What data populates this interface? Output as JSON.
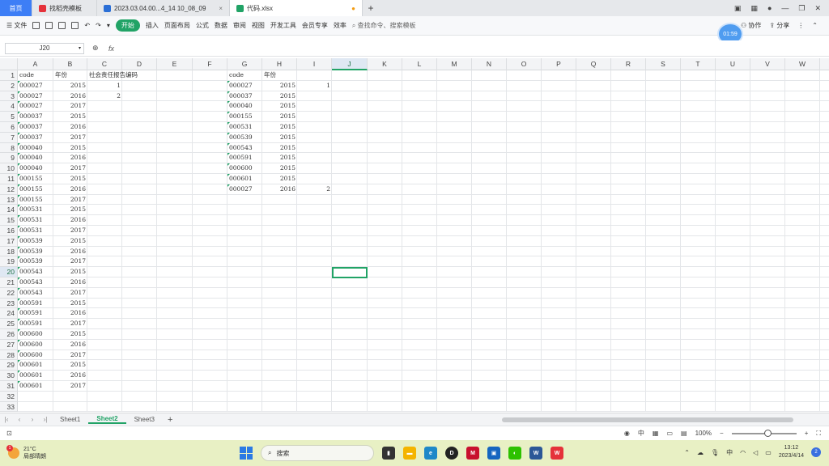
{
  "tabs": {
    "home": "首页",
    "tab1": "找稻壳模板",
    "tab2": "2023.03.04.00...4_14 10_08_09",
    "tab3": "代码.xlsx"
  },
  "colors": {
    "accent": "#21a366",
    "home_tab": "#3d7ef6"
  },
  "ribbon": {
    "menu": "文件",
    "start": "开始",
    "insert": "插入",
    "layout": "页面布局",
    "formula": "公式",
    "data": "数据",
    "review": "审阅",
    "view": "视图",
    "devtools": "开发工具",
    "member": "会员专享",
    "efficiency": "效率",
    "search": "查找命令、搜索模板",
    "collab": "协作",
    "share": "分享",
    "timer": "01:59"
  },
  "formula_bar": {
    "namebox": "J20",
    "fx": "fx"
  },
  "columns": [
    "A",
    "B",
    "C",
    "D",
    "E",
    "F",
    "G",
    "H",
    "I",
    "J",
    "K",
    "L",
    "M",
    "N",
    "O",
    "P",
    "Q",
    "R",
    "S",
    "T",
    "U",
    "V",
    "W"
  ],
  "rows": [
    "1",
    "2",
    "3",
    "4",
    "5",
    "6",
    "7",
    "8",
    "9",
    "10",
    "11",
    "12",
    "13",
    "14",
    "15",
    "16",
    "17",
    "18",
    "19",
    "20",
    "21",
    "22",
    "23",
    "24",
    "25",
    "26",
    "27",
    "28",
    "29",
    "30",
    "31",
    "32",
    "33"
  ],
  "sheet": {
    "A": [
      "code",
      "000027",
      "000027",
      "000027",
      "000037",
      "000037",
      "000037",
      "000040",
      "000040",
      "000040",
      "000155",
      "000155",
      "000155",
      "000531",
      "000531",
      "000531",
      "000539",
      "000539",
      "000539",
      "000543",
      "000543",
      "000543",
      "000591",
      "000591",
      "000591",
      "000600",
      "000600",
      "000600",
      "000601",
      "000601",
      "000601"
    ],
    "B": [
      "年份",
      "2015",
      "2016",
      "2017",
      "2015",
      "2016",
      "2017",
      "2015",
      "2016",
      "2017",
      "2015",
      "2016",
      "2017",
      "2015",
      "2016",
      "2017",
      "2015",
      "2016",
      "2017",
      "2015",
      "2016",
      "2017",
      "2015",
      "2016",
      "2017",
      "2015",
      "2016",
      "2017",
      "2015",
      "2016",
      "2017"
    ],
    "C": [
      "社会责任报告编码",
      "1",
      "2"
    ],
    "G": [
      "code",
      "000027",
      "000037",
      "000040",
      "000155",
      "000531",
      "000539",
      "000543",
      "000591",
      "000600",
      "000601",
      "000027"
    ],
    "H": [
      "年份",
      "2015",
      "2015",
      "2015",
      "2015",
      "2015",
      "2015",
      "2015",
      "2015",
      "2015",
      "2015",
      "2016"
    ],
    "I": [
      "",
      "1",
      "",
      "",
      "",
      "",
      "",
      "",
      "",
      "",
      "",
      "2"
    ]
  },
  "sheets": [
    "Sheet1",
    "Sheet2",
    "Sheet3"
  ],
  "active_sheet": "Sheet2",
  "status": {
    "zoom": "100%"
  },
  "taskbar": {
    "temp": "21°C",
    "weather": "局部晴朗",
    "search": "搜索",
    "ime": "中",
    "time": "13:12",
    "date": "2023/4/14",
    "notifications": "2"
  }
}
